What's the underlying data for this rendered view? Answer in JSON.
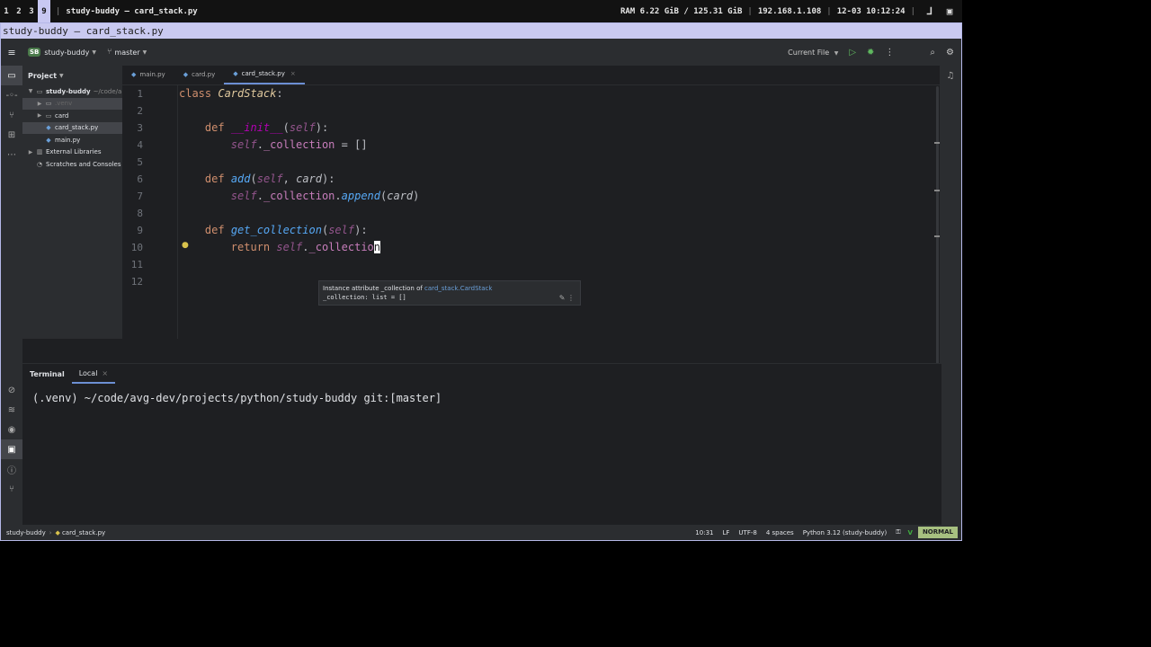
{
  "wm": {
    "workspaces": [
      "1",
      "2",
      "3",
      "9"
    ],
    "active_workspace": "9",
    "window_title": "study-buddy – card_stack.py",
    "ram": "RAM 6.22 GiB / 125.31 GiB",
    "ip": "192.168.1.108",
    "datetime": "12-03 10:12:24"
  },
  "window": {
    "title": "study-buddy – card_stack.py"
  },
  "toolbar": {
    "project_badge": "SB",
    "project_name": "study-buddy",
    "branch": "master",
    "run_config": "Current File"
  },
  "project_panel": {
    "title": "Project",
    "root_label": "study-buddy",
    "root_path": "~/code/a",
    "items": [
      {
        "label": ".venv"
      },
      {
        "label": "card"
      },
      {
        "label": "card_stack.py"
      },
      {
        "label": "main.py"
      }
    ],
    "external": "External Libraries",
    "scratches": "Scratches and Consoles"
  },
  "tabs": [
    {
      "label": "main.py"
    },
    {
      "label": "card.py"
    },
    {
      "label": "card_stack.py"
    }
  ],
  "line_numbers": [
    "1",
    "2",
    "3",
    "4",
    "5",
    "6",
    "7",
    "8",
    "9",
    "10",
    "11",
    "12"
  ],
  "code": {
    "l1_kw": "class ",
    "l1_name": "CardStack",
    "l1_colon": ":",
    "l3_def": "def ",
    "l3_name": "__init__",
    "l3_open": "(",
    "l3_self": "self",
    "l3_close": "):",
    "l4_self": "self",
    "l4_dot": ".",
    "l4_attr": "_collection",
    "l4_rest": " = []",
    "l6_def": "def ",
    "l6_name": "add",
    "l6_open": "(",
    "l6_self": "self",
    "l6_comma": ", ",
    "l6_param": "card",
    "l6_close": "):",
    "l7_self": "self",
    "l7_dot": ".",
    "l7_attr": "_collection",
    "l7_dot2": ".",
    "l7_method": "append",
    "l7_open": "(",
    "l7_param": "card",
    "l7_close": ")",
    "l9_def": "def ",
    "l9_name": "get_collection",
    "l9_open": "(",
    "l9_self": "self",
    "l9_close": "):",
    "l10_ret": "return ",
    "l10_self": "self",
    "l10_dot": ".",
    "l10_attr": "_collectio",
    "l10_cursor": "n"
  },
  "tooltip": {
    "line1_prefix": "Instance attribute _collection of ",
    "line1_link": "card_stack.CardStack",
    "line2": "_collection: list = []"
  },
  "terminal": {
    "tab_terminal": "Terminal",
    "tab_local": "Local",
    "prompt": "(.venv) ~/code/avg-dev/projects/python/study-buddy git:[master]"
  },
  "status": {
    "crumb_project": "study-buddy",
    "crumb_file": "card_stack.py",
    "position": "10:31",
    "line_sep": "LF",
    "encoding": "UTF-8",
    "indent": "4 spaces",
    "interpreter": "Python 3.12 (study-buddy)",
    "mode": "NORMAL"
  }
}
